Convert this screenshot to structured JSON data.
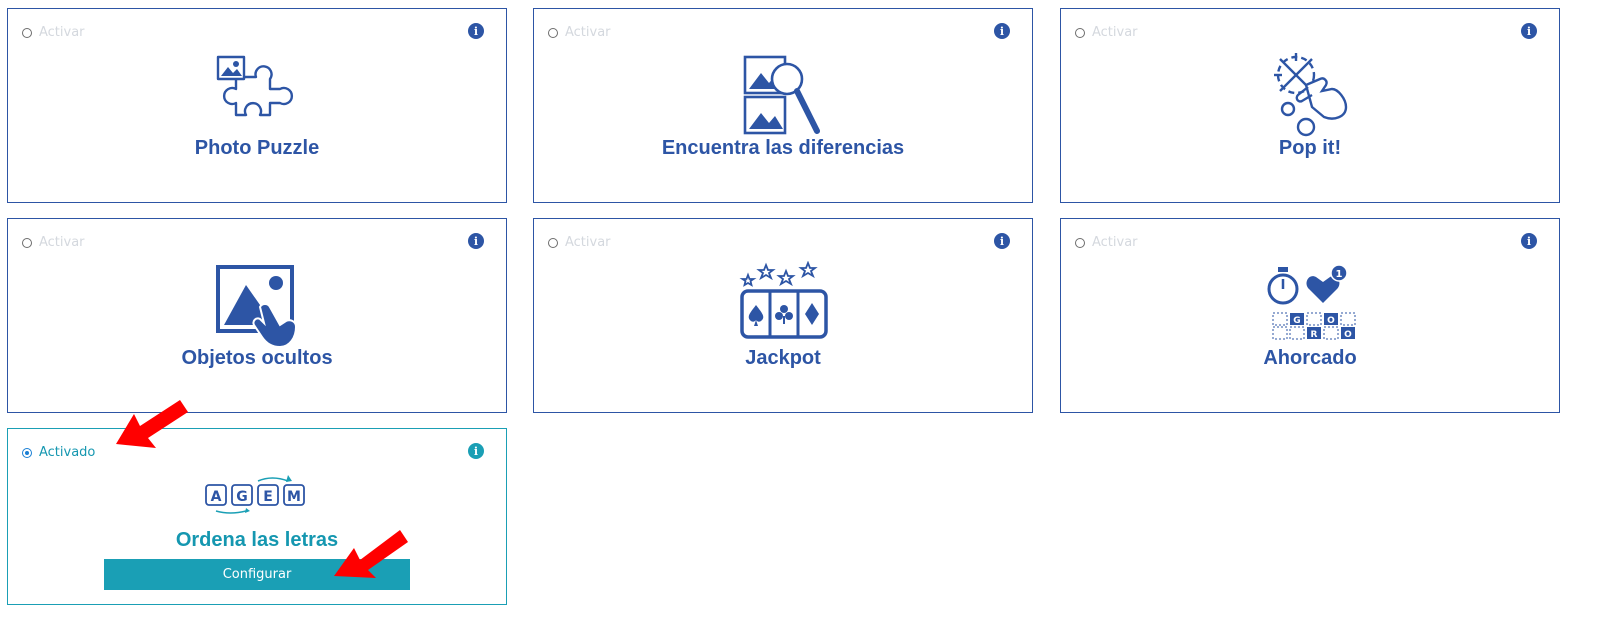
{
  "cards": [
    {
      "title": "Photo Puzzle",
      "radio_label": "Activar",
      "icon": "puzzle-photo-icon"
    },
    {
      "title": "Encuentra las diferencias",
      "radio_label": "Activar",
      "icon": "find-differences-icon"
    },
    {
      "title": "Pop it!",
      "radio_label": "Activar",
      "icon": "pop-bubbles-icon"
    },
    {
      "title": "Objetos ocultos",
      "radio_label": "Activar",
      "icon": "hidden-objects-icon"
    },
    {
      "title": "Jackpot",
      "radio_label": "Activar",
      "icon": "jackpot-cards-icon"
    },
    {
      "title": "Ahorcado",
      "radio_label": "Activar",
      "icon": "hangman-icon"
    },
    {
      "title": "Ordena las letras",
      "radio_label": "Activado",
      "icon": "scramble-letters-icon",
      "active": true,
      "button_label": "Configurar"
    }
  ],
  "info_glyph": "i",
  "hangman_letters": [
    "G",
    "O",
    "R",
    "O"
  ],
  "hangman_badge": "1",
  "scramble_letters": [
    "A",
    "G",
    "E",
    "M"
  ],
  "colors": {
    "primary": "#2d55a5",
    "active": "#1a9fb5",
    "annotation_arrow": "#ff0000"
  }
}
